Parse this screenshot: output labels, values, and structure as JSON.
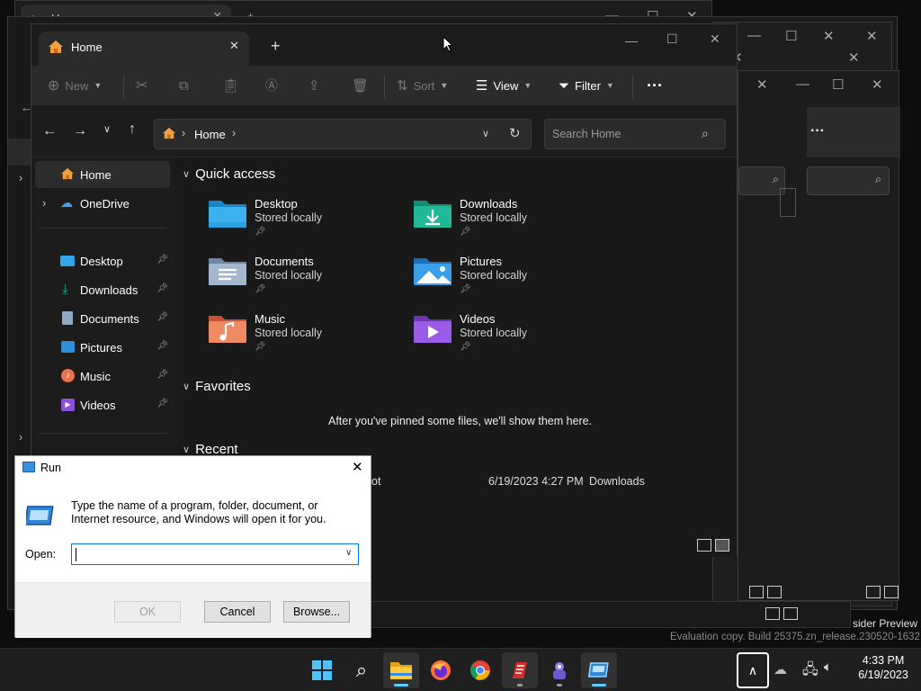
{
  "explorer": {
    "tab_title": "Home",
    "bg_tab_title": "Home",
    "toolbar": {
      "new_label": "New",
      "sort_label": "Sort",
      "view_label": "View",
      "filter_label": "Filter"
    },
    "address": {
      "location": "Home",
      "search_placeholder": "Search Home"
    },
    "sidebar": {
      "home": "Home",
      "onedrive": "OneDrive",
      "pinned": [
        "Desktop",
        "Downloads",
        "Documents",
        "Pictures",
        "Music",
        "Videos"
      ]
    },
    "quick_access": {
      "heading": "Quick access",
      "tiles": [
        {
          "name": "Desktop",
          "status": "Stored locally",
          "color": "#2ea6e8"
        },
        {
          "name": "Downloads",
          "status": "Stored locally",
          "color": "#1ab394"
        },
        {
          "name": "Documents",
          "status": "Stored locally",
          "color": "#8fa7c0"
        },
        {
          "name": "Pictures",
          "status": "Stored locally",
          "color": "#2d8fd6"
        },
        {
          "name": "Music",
          "status": "Stored locally",
          "color": "#e9744f"
        },
        {
          "name": "Videos",
          "status": "Stored locally",
          "color": "#8e4fd8"
        }
      ]
    },
    "favorites": {
      "heading": "Favorites",
      "empty_text": "After you've pinned some files, we'll show them here."
    },
    "recent": {
      "heading": "Recent",
      "row": {
        "name_fragment": "ot",
        "date": "6/19/2023 4:27 PM",
        "location": "Downloads"
      }
    }
  },
  "run_dialog": {
    "title": "Run",
    "description": "Type the name of a program, folder, document, or Internet resource, and Windows will open it for you.",
    "open_label": "Open:",
    "open_value": "",
    "ok_label": "OK",
    "cancel_label": "Cancel",
    "browse_label": "Browse..."
  },
  "watermark": {
    "line1": "sider Preview",
    "line2": "Evaluation copy. Build 25375.zn_release.230520-1632"
  },
  "taskbar": {
    "time": "4:33 PM",
    "date": "6/19/2023",
    "accent": "#60cdff"
  }
}
